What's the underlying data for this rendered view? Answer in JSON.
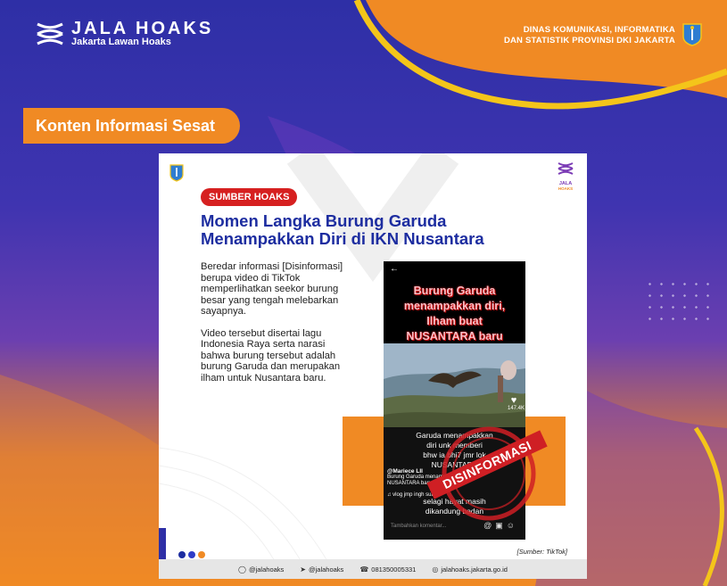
{
  "header": {
    "brand_title": "JALA HOAKS",
    "brand_subtitle": "Jakarta Lawan Hoaks",
    "dinas_line1": "DINAS KOMUNIKASI, INFORMATIKA",
    "dinas_line2": "DAN STATISTIK PROVINSI DKI JAKARTA"
  },
  "ribbon": "Konten Informasi Sesat",
  "card": {
    "logo_line1": "JALA",
    "logo_line2": "HOAKS",
    "badge": "SUMBER HOAKS",
    "headline_line1": "Momen Langka Burung Garuda",
    "headline_line2": "Menampakkan Diri di IKN Nusantara",
    "paragraph1": "Beredar informasi [Disinformasi] berupa video di TikTok memperlihatkan seekor burung besar yang tengah melebarkan sayapnya.",
    "paragraph2": "Video tersebut disertai lagu Indonesia Raya serta narasi bahwa burung tersebut adalah burung Garuda dan merupakan ilham untuk Nusantara baru.",
    "tiktok_overlay": [
      "Burung Garuda",
      "menampakkan diri,",
      "Ilham buat",
      "NUSANTARA baru"
    ],
    "video_caption": [
      "Garuda menampakkan",
      "diri unk memberi",
      "bhw ia bhi7 jmr lok",
      "NUSANTARA",
      "selagi hayat masih",
      "dikandung badan"
    ],
    "like_count": "147.4K",
    "tiktok_user": "@Mariece LII",
    "tiktok_desc": "Burung Garuda menampakkan diri, NUSANTARA baru",
    "sound": "♫  vlog jmp ingh suara",
    "comment_placeholder": "Tambahkan komentar...",
    "stamp": "DISINFORMASI",
    "source": "[Sumber: TikTok]",
    "dot_colors": [
      "#1d2da0",
      "#2e3cc7",
      "#f08a24"
    ]
  },
  "footer": {
    "instagram": "@jalahoaks",
    "twitter": "@jalahoaks",
    "whatsapp": "081350005331",
    "website": "jalahoaks.jakarta.go.id"
  }
}
